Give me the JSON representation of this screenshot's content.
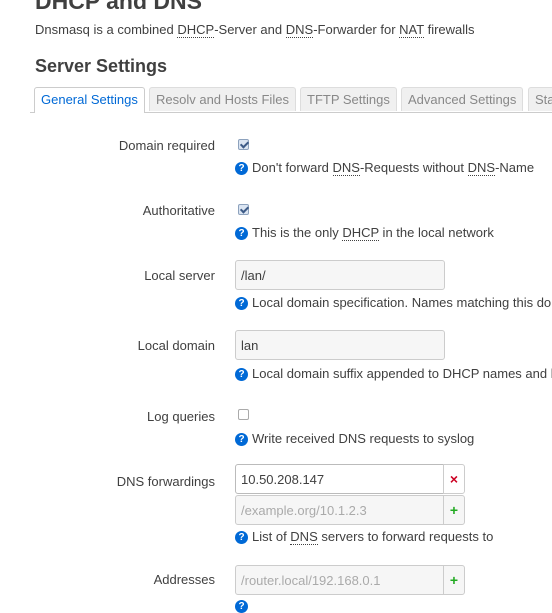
{
  "page": {
    "title": "DHCP and DNS",
    "description_parts": [
      "Dnsmasq is a combined ",
      "DHCP",
      "-Server and ",
      "DNS",
      "-Forwarder for ",
      "NAT",
      " firewalls"
    ]
  },
  "section": {
    "title": "Server Settings"
  },
  "tabs": [
    {
      "label": "General Settings",
      "active": true
    },
    {
      "label": "Resolv and Hosts Files",
      "active": false
    },
    {
      "label": "TFTP Settings",
      "active": false
    },
    {
      "label": "Advanced Settings",
      "active": false
    },
    {
      "label": "Sta",
      "active": false
    }
  ],
  "fields": {
    "domain_required": {
      "label": "Domain required",
      "checked": true,
      "help_parts": [
        "Don't forward ",
        "DNS",
        "-Requests without ",
        "DNS",
        "-Name"
      ]
    },
    "authoritative": {
      "label": "Authoritative",
      "checked": true,
      "help_parts": [
        "This is the only ",
        "DHCP",
        " in the local network"
      ]
    },
    "local_server": {
      "label": "Local server",
      "value": "/lan/",
      "help": "Local domain specification. Names matching this do"
    },
    "local_domain": {
      "label": "Local domain",
      "value": "lan",
      "help": "Local domain suffix appended to DHCP names and h"
    },
    "log_queries": {
      "label": "Log queries",
      "checked": false,
      "help": "Write received DNS requests to syslog"
    },
    "dns_forwardings": {
      "label": "DNS forwardings",
      "value": "10.50.208.147",
      "placeholder": "/example.org/10.1.2.3",
      "remove_symbol": "×",
      "add_symbol": "+",
      "help_parts": [
        "List of ",
        "DNS",
        " servers to forward requests to"
      ]
    },
    "addresses": {
      "label": "Addresses",
      "placeholder": "/router.local/192.168.0.1",
      "add_symbol": "+"
    }
  },
  "icons": {
    "help": "help-icon",
    "help_color": "#0069d6",
    "help_glyph": "?"
  },
  "colors": {
    "accent": "#0069d6",
    "remove": "#cc0022",
    "add": "#22aa22"
  }
}
